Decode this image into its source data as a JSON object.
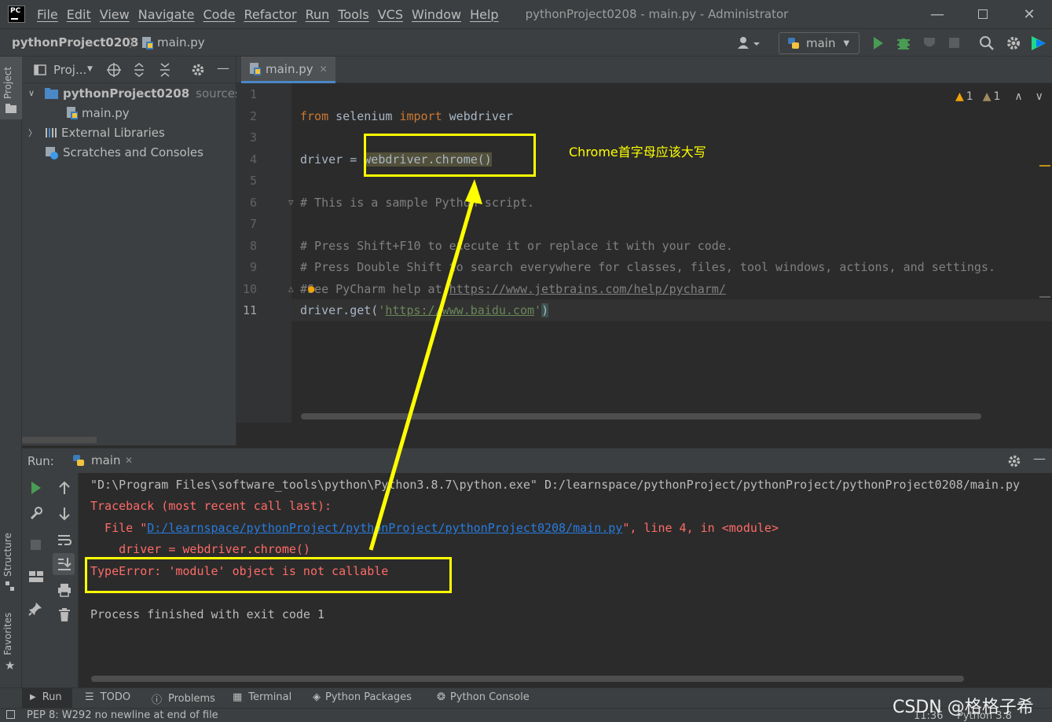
{
  "menubar": {
    "items": [
      "File",
      "Edit",
      "View",
      "Navigate",
      "Code",
      "Refactor",
      "Run",
      "Tools",
      "VCS",
      "Window",
      "Help"
    ],
    "window_title": "pythonProject0208 - main.py - Administrator"
  },
  "navbar": {
    "project": "pythonProject0208",
    "file": "main.py",
    "run_config": "main"
  },
  "left_stripe": {
    "project": "Project",
    "structure": "Structure",
    "favorites": "Favorites"
  },
  "project_panel": {
    "title": "Proj...",
    "tree": {
      "root": "pythonProject0208",
      "root_suffix": "sources r",
      "file": "main.py",
      "external": "External Libraries",
      "scratches": "Scratches and Consoles"
    }
  },
  "editor": {
    "tab": "main.py",
    "inspection_warnings": "1",
    "inspection_weak": "1",
    "line_numbers": [
      "1",
      "2",
      "3",
      "4",
      "5",
      "6",
      "7",
      "8",
      "9",
      "10",
      "11"
    ],
    "code": {
      "l2_from": "from",
      "l2_mid": " selenium ",
      "l2_import": "import",
      "l2_end": " webdriver",
      "l4_pre": "driver = ",
      "l4_call": "webdriver.chrome()",
      "l6": "# This is a sample Python script.",
      "l8": "# Press Shift+F10 to execute it or replace it with your code.",
      "l9": "# Press Double Shift to search everywhere for classes, files, tool windows, actions, and settings.",
      "l10_pre": "#See PyCharm help at ",
      "l10_url": "https://www.jetbrains.com/help/pycharm/",
      "l11_pre": "driver.get(",
      "l11_q1": "'",
      "l11_url": "https://www.baidu.com",
      "l11_q2": "'",
      "l11_end": ")"
    }
  },
  "run_panel": {
    "label": "Run:",
    "tab": "main",
    "console": {
      "cmd": "\"D:\\Program Files\\software_tools\\python\\Python3.8.7\\python.exe\" D:/learnspace/pythonProject/pythonProject/pythonProject0208/main.py",
      "traceback": "Traceback (most recent call last):",
      "file_pre": "  File \"",
      "file_link": "D:/learnspace/pythonProject/pythonProject/pythonProject0208/main.py",
      "file_post": "\", line 4, in <module>",
      "code_line": "    driver = webdriver.chrome()",
      "error": "TypeError: 'module' object is not callable",
      "finished": "Process finished with exit code 1"
    }
  },
  "bottom_tabs": [
    "Run",
    "TODO",
    "Problems",
    "Terminal",
    "Python Packages",
    "Python Console"
  ],
  "statusbar": {
    "message": "PEP 8: W292 no newline at end of file",
    "time": "11:36",
    "interpreter": "Python 3.8"
  },
  "annotation": {
    "note": "Chrome首字母应该大写",
    "watermark": "CSDN @格格子希"
  },
  "colors": {
    "highlight": "#ffff00",
    "error": "#ff6b68",
    "keyword": "#cc7832",
    "comment": "#808080",
    "string": "#6a8759",
    "link": "#287bde",
    "run_green": "#499c54"
  }
}
